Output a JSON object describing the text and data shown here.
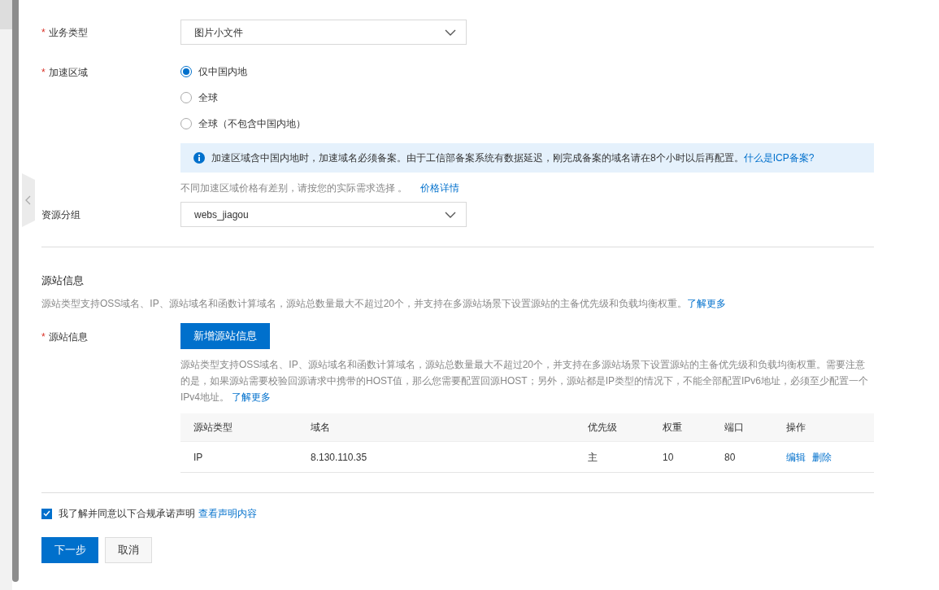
{
  "business_type": {
    "marker": "*",
    "label": "业务类型",
    "value": "图片小文件"
  },
  "region": {
    "marker": "*",
    "label": "加速区域",
    "options": [
      {
        "label": "仅中国内地",
        "selected": true
      },
      {
        "label": "全球",
        "selected": false
      },
      {
        "label": "全球（不包含中国内地）",
        "selected": false
      }
    ],
    "notice": {
      "text": "加速区域含中国内地时，加速域名必须备案。由于工信部备案系统有数据延迟，刚完成备案的域名请在8个小时以后再配置。",
      "link": "什么是ICP备案?"
    },
    "hint": "不同加速区域价格有差别，请按您的实际需求选择 。",
    "hint_link": "价格详情"
  },
  "resource_group": {
    "label": "资源分组",
    "value": "webs_jiagou"
  },
  "origin_section": {
    "title": "源站信息",
    "description": "源站类型支持OSS域名、IP、源站域名和函数计算域名，源站总数量最大不超过20个，并支持在多源站场景下设置源站的主备优先级和负载均衡权重。",
    "link": "了解更多"
  },
  "origin": {
    "marker": "*",
    "label": "源站信息",
    "add_button": "新增源站信息",
    "description": "源站类型支持OSS域名、IP、源站域名和函数计算域名，源站总数量最大不超过20个，并支持在多源站场景下设置源站的主备优先级和负载均衡权重。需要注意的是，如果源站需要校验回源请求中携带的HOST值，那么您需要配置回源HOST；另外，源站都是IP类型的情况下，不能全部配置IPv6地址，必须至少配置一个IPv4地址。",
    "link": "了解更多",
    "table": {
      "columns": [
        "源站类型",
        "域名",
        "优先级",
        "权重",
        "端口",
        "操作"
      ],
      "rows": [
        {
          "cells": [
            "IP",
            "8.130.110.35",
            "主",
            "10",
            "80"
          ],
          "actions": [
            "编辑",
            "删除"
          ]
        }
      ]
    }
  },
  "agreement": {
    "checked": true,
    "text": "我了解并同意以下合规承诺声明",
    "link": "查看声明内容"
  },
  "buttons": [
    {
      "label": "下一步",
      "kind": "primary"
    },
    {
      "label": "取消",
      "kind": "secondary"
    }
  ]
}
